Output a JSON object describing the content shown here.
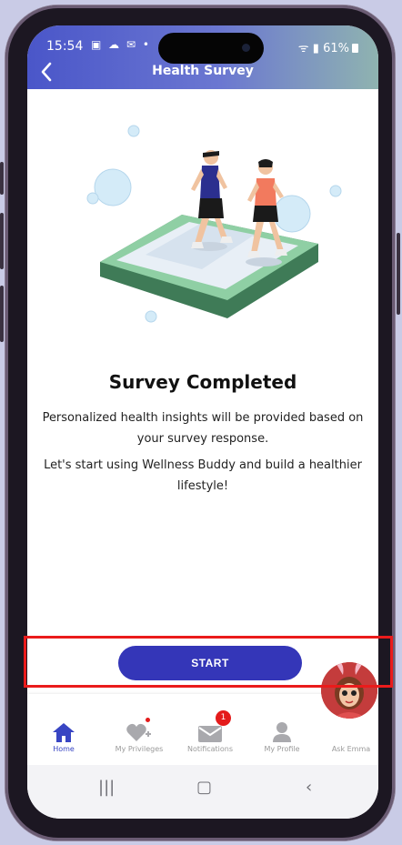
{
  "status_bar": {
    "time": "15:54",
    "left_icons": "▣ ☁ ✉ •",
    "right_text": "61%",
    "signal": "ᯤ ▮"
  },
  "header": {
    "title": "Health Survey",
    "gradient_start": "#4a56c9",
    "gradient_end": "#8fb3b0"
  },
  "illustration": {
    "description_icon": "runners-illustration"
  },
  "content": {
    "title": "Survey Completed",
    "paragraph1": "Personalized health insights will be provided based on your survey response.",
    "paragraph2": "Let's start using Wellness Buddy and build a healthier lifestyle!"
  },
  "actions": {
    "start_label": "START",
    "start_color": "#3436b8"
  },
  "bottom_nav": {
    "items": [
      {
        "label": "Home",
        "icon": "home-icon",
        "active": true
      },
      {
        "label": "My Privileges",
        "icon": "heart-plus-icon",
        "active": false
      },
      {
        "label": "Notifications",
        "icon": "mail-icon",
        "active": false,
        "badge": "1"
      },
      {
        "label": "My Profile",
        "icon": "person-icon",
        "active": false
      },
      {
        "label": "Ask Emma",
        "icon": "emma-avatar",
        "active": false
      }
    ],
    "active_color": "#3845c3"
  },
  "system_nav": {
    "recent": "|||",
    "home": "▢",
    "back": "‹"
  }
}
